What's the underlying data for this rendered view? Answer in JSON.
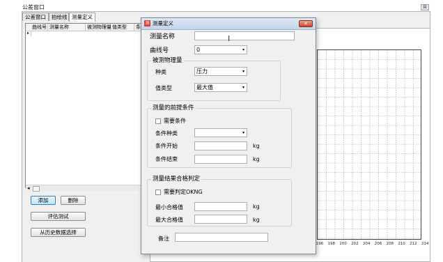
{
  "window": {
    "title": "公差窗口",
    "close_glyph": "⊠"
  },
  "tabs": [
    {
      "label": "公差窗口"
    },
    {
      "label": "拍绘线"
    },
    {
      "label": "测量定义"
    }
  ],
  "grid": {
    "columns": [
      "曲线号",
      "测量名称",
      "被测物理量",
      "值类型",
      "条"
    ],
    "row_marker": "▸"
  },
  "buttons": {
    "add": "添加",
    "delete": "删除",
    "eval_test": "评估测试",
    "history_select": "从历史数据选择"
  },
  "dialog": {
    "title": "测量定义",
    "close_glyph": "✕",
    "icon_glyph": "测",
    "measure_name_label": "测量名称",
    "measure_name_value": "",
    "curve_no_label": "曲线号",
    "curve_no_value": "0",
    "measured_qty": {
      "title": "被测物理量",
      "kind_label": "种类",
      "kind_value": "压力",
      "value_type_label": "值类型",
      "value_type_value": "最大值"
    },
    "precondition": {
      "title": "测量的前提条件",
      "need_condition_label": "需要条件",
      "condition_kind_label": "条件种类",
      "condition_kind_value": "",
      "condition_start_label": "条件开始",
      "condition_start_value": "",
      "condition_start_unit": "kg",
      "condition_end_label": "条件结束",
      "condition_end_value": "",
      "condition_end_unit": "kg"
    },
    "result_judge": {
      "title": "测量结果合格判定",
      "need_judge_label": "需要判定OKNG",
      "min_label": "最小合格值",
      "min_value": "",
      "min_unit": "kg",
      "max_label": "最大合格值",
      "max_value": "",
      "max_unit": "kg"
    },
    "remark_label": "备注",
    "remark_value": ""
  },
  "plot": {
    "x_ticks": [
      "196",
      "198",
      "200",
      "202",
      "204",
      "206",
      "208",
      "210",
      "212",
      "214"
    ]
  },
  "icons": {
    "dropdown": "▾",
    "text_cursor": "I",
    "scroll_left": "◂"
  }
}
